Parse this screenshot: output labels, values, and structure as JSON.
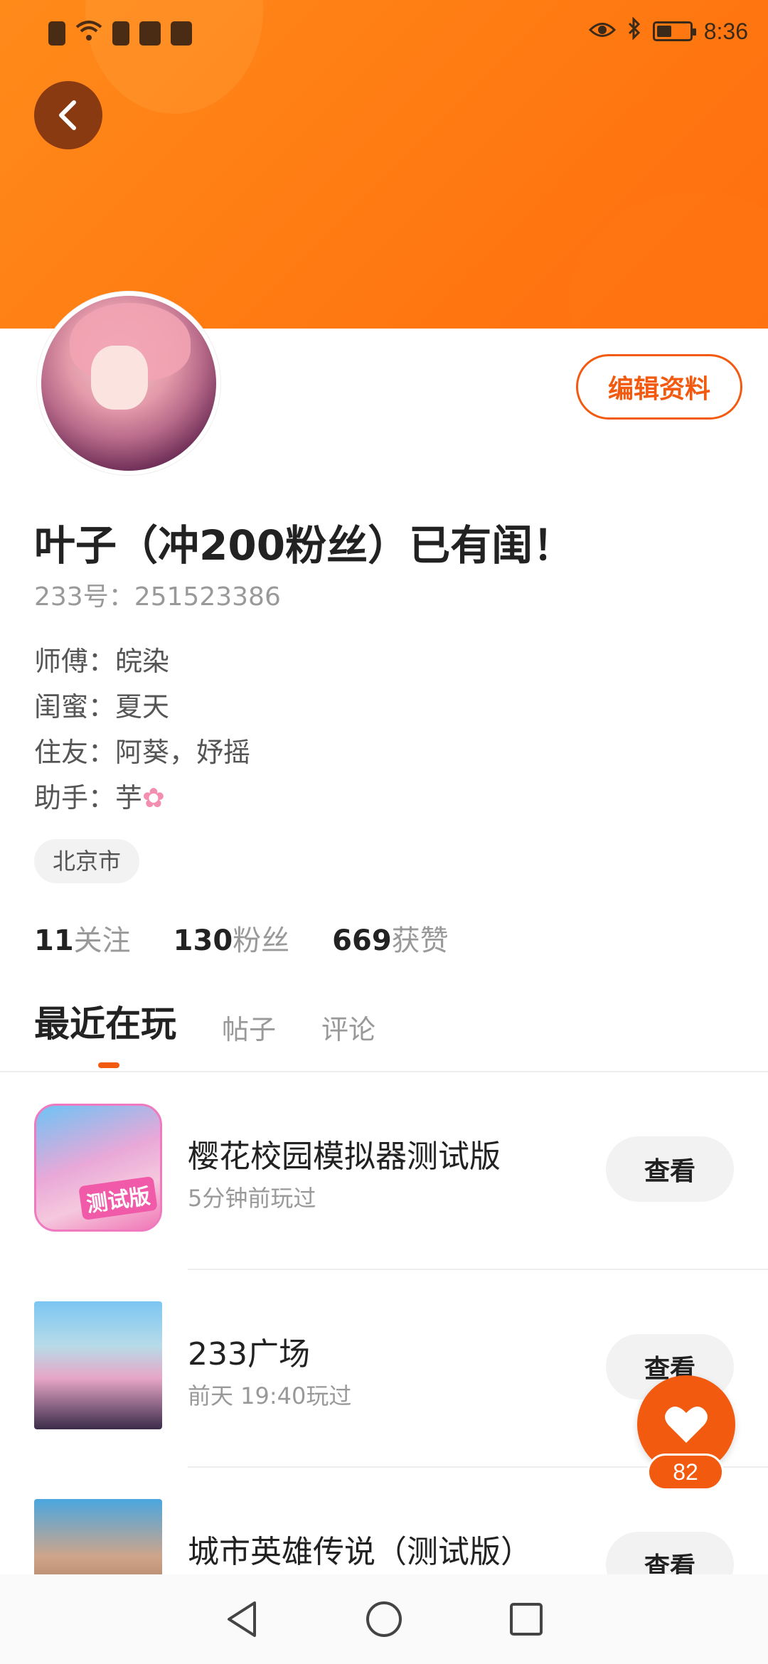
{
  "status_bar": {
    "time": "8:36",
    "battery_level": 0.45
  },
  "header": {
    "back_icon": "chevron-left-icon"
  },
  "profile": {
    "edit_label": "编辑资料",
    "name": "叶子（冲200粉丝）已有闺！",
    "uid": "233号：251523386",
    "relations": [
      {
        "label": "师傅：",
        "value": "皖染"
      },
      {
        "label": "闺蜜：",
        "value": "夏天"
      },
      {
        "label": "住友：",
        "value": "阿葵，妤摇"
      },
      {
        "label": "助手：",
        "value": "芋"
      }
    ],
    "location": "北京市",
    "stats": [
      {
        "num": "11",
        "label": "关注"
      },
      {
        "num": "130",
        "label": "粉丝"
      },
      {
        "num": "669",
        "label": "获赞"
      }
    ]
  },
  "tabs": [
    {
      "label": "最近在玩",
      "active": true
    },
    {
      "label": "帖子",
      "active": false
    },
    {
      "label": "评论",
      "active": false
    }
  ],
  "games": [
    {
      "title": "樱花校园模拟器测试版",
      "sub": "5分钟前玩过",
      "button": "查看",
      "badge": "测试版"
    },
    {
      "title": "233广场",
      "sub": "前天 19:40玩过",
      "button": "查看"
    },
    {
      "title": "城市英雄传说（测试版）",
      "sub": "",
      "button": "查看"
    }
  ],
  "like": {
    "count": "82",
    "icon": "heart-icon"
  },
  "colors": {
    "accent": "#f25a10",
    "banner": "#ff7a12"
  }
}
